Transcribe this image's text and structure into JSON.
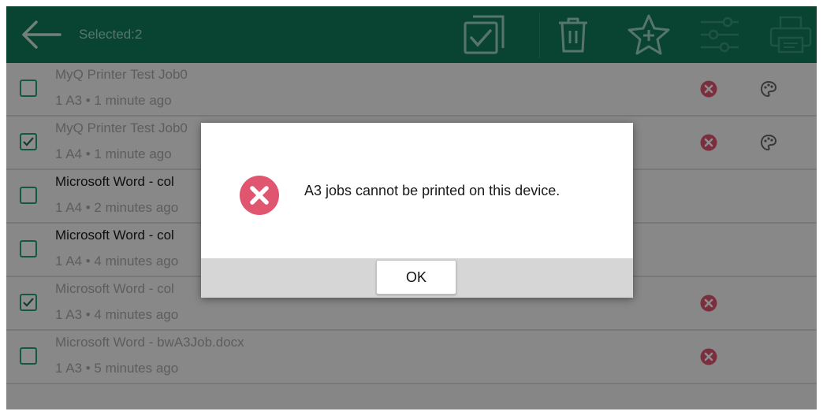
{
  "header": {
    "selected_label": "Selected:2",
    "icons": [
      "back-arrow-icon",
      "select-all-icon",
      "trash-icon",
      "star-plus-icon",
      "settings-sliders-icon",
      "printer-icon"
    ]
  },
  "jobs": [
    {
      "title": "MyQ Printer Test Job0",
      "subtitle": "1 A3 • 1 minute ago",
      "checked": false,
      "dim": true,
      "delete_icon": true,
      "color_icon": true
    },
    {
      "title": "MyQ Printer Test Job0",
      "subtitle": "1 A4 • 1 minute ago",
      "checked": true,
      "dim": true,
      "delete_icon": true,
      "color_icon": true
    },
    {
      "title": "Microsoft Word - col",
      "subtitle": "1 A4 • 2 minutes ago",
      "checked": false,
      "dim": false,
      "delete_icon": false,
      "color_icon": false
    },
    {
      "title": "Microsoft Word - col",
      "subtitle": "1 A4 • 4 minutes ago",
      "checked": false,
      "dim": false,
      "delete_icon": false,
      "color_icon": false
    },
    {
      "title": "Microsoft Word - col",
      "subtitle": "1 A3 • 4 minutes ago",
      "checked": true,
      "dim": true,
      "delete_icon": true,
      "color_icon": false
    },
    {
      "title": "Microsoft Word - bwA3Job.docx",
      "subtitle": "1 A3 • 5 minutes ago",
      "checked": false,
      "dim": true,
      "delete_icon": true,
      "color_icon": false
    }
  ],
  "dialog": {
    "icon": "error-x-icon",
    "message": "A3 jobs cannot be printed on this device.",
    "ok_label": "OK"
  },
  "colors": {
    "header_bg": "#0f7d5a",
    "accent": "#23a07a",
    "error": "#e0556f",
    "overlay": "rgba(0,0,0,0.45)"
  }
}
